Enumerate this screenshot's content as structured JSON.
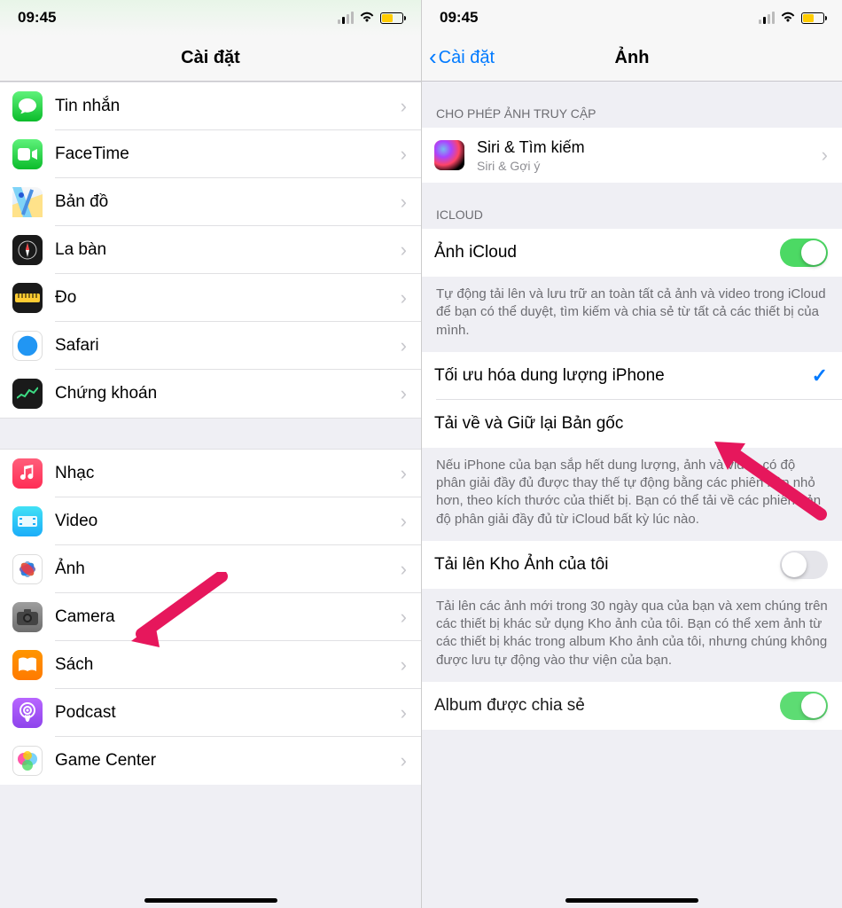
{
  "statusbar": {
    "time": "09:45"
  },
  "left": {
    "title": "Cài đặt",
    "group1": [
      {
        "key": "messages",
        "label": "Tin nhắn"
      },
      {
        "key": "facetime",
        "label": "FaceTime"
      },
      {
        "key": "maps",
        "label": "Bản đồ"
      },
      {
        "key": "compass",
        "label": "La bàn"
      },
      {
        "key": "measure",
        "label": "Đo"
      },
      {
        "key": "safari",
        "label": "Safari"
      },
      {
        "key": "stocks",
        "label": "Chứng khoán"
      }
    ],
    "group2": [
      {
        "key": "music",
        "label": "Nhạc"
      },
      {
        "key": "video",
        "label": "Video"
      },
      {
        "key": "photos",
        "label": "Ảnh"
      },
      {
        "key": "camera",
        "label": "Camera"
      },
      {
        "key": "books",
        "label": "Sách"
      },
      {
        "key": "podcast",
        "label": "Podcast"
      },
      {
        "key": "gamecenter",
        "label": "Game Center"
      }
    ]
  },
  "right": {
    "back": "Cài đặt",
    "title": "Ảnh",
    "section_access": "CHO PHÉP ẢNH TRUY CẬP",
    "siri": {
      "label": "Siri & Tìm kiếm",
      "sub": "Siri & Gợi ý"
    },
    "section_icloud": "ICLOUD",
    "icloud_photos": {
      "label": "Ảnh iCloud",
      "on": true
    },
    "icloud_desc": "Tự động tải lên và lưu trữ an toàn tất cả ảnh và video trong iCloud để bạn có thể duyệt, tìm kiếm và chia sẻ từ tất cả các thiết bị của mình.",
    "opt1": "Tối ưu hóa dung lượng iPhone",
    "opt2": "Tải về và Giữ lại Bản gốc",
    "opt_desc": "Nếu iPhone của bạn sắp hết dung lượng, ảnh và video có độ phân giải đầy đủ được thay thế tự động bằng các phiên bản nhỏ hơn, theo kích thước của thiết bị. Bạn có thể tải về các phiên bản độ phân giải đầy đủ từ iCloud bất kỳ lúc nào.",
    "upload": {
      "label": "Tải lên Kho Ảnh của tôi",
      "on": false
    },
    "upload_desc": "Tải lên các ảnh mới trong 30 ngày qua của bạn và xem chúng trên các thiết bị khác sử dụng Kho ảnh của tôi. Bạn có thể xem ảnh từ các thiết bị khác trong album Kho ảnh của tôi, nhưng chúng không được lưu tự động vào thư viện của bạn.",
    "shared": {
      "label": "Album được chia sẻ",
      "on": true
    }
  }
}
